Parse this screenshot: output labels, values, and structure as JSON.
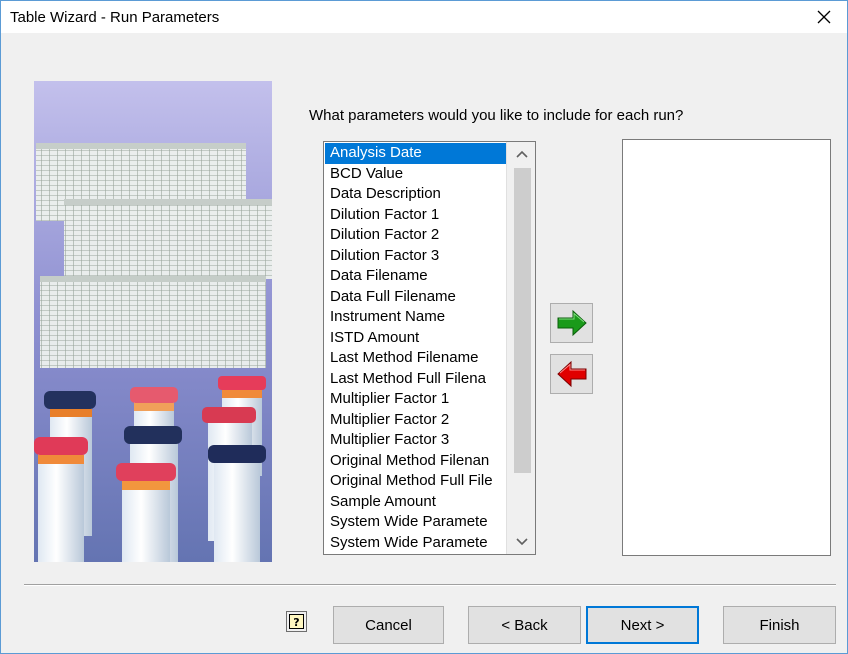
{
  "window": {
    "title": "Table Wizard - Run Parameters",
    "close_icon": "close-icon"
  },
  "question": "What parameters would you like to include for each run?",
  "available_parameters": [
    "Analysis Date",
    "BCD Value",
    "Data Description",
    "Dilution Factor 1",
    "Dilution Factor 2",
    "Dilution Factor 3",
    "Data Filename",
    "Data Full Filename",
    "Instrument Name",
    "ISTD Amount",
    "Last Method Filename",
    "Last Method Full Filena",
    "Multiplier Factor 1",
    "Multiplier Factor 2",
    "Multiplier Factor 3",
    "Original Method Filenan",
    "Original Method Full File",
    "Sample Amount",
    "System Wide Paramete",
    "System Wide Paramete"
  ],
  "selected_index": 0,
  "selected_parameters": [],
  "buttons": {
    "add_icon": "green-right-arrow-icon",
    "remove_icon": "red-left-arrow-icon",
    "help_icon": "help-icon",
    "cancel": "Cancel",
    "back": "< Back",
    "next": "Next >",
    "finish": "Finish"
  },
  "colors": {
    "selection": "#0078d7",
    "add_arrow": "#1a9a1a",
    "remove_arrow": "#e00000"
  }
}
